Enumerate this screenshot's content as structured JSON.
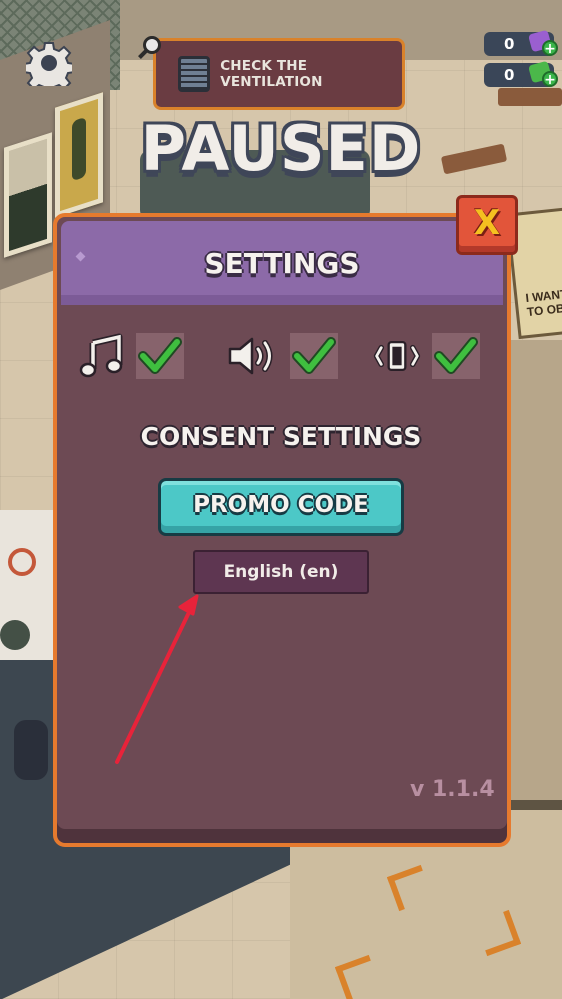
{
  "hud": {
    "objective_label": "CHECK THE VENTILATION",
    "currencies": [
      {
        "icon": "purple-gem-icon",
        "amount": "0",
        "color": "#9a5fd0"
      },
      {
        "icon": "green-cash-icon",
        "amount": "0",
        "color": "#4bb84a"
      }
    ]
  },
  "status_title": "PAUSED",
  "settings": {
    "title": "SETTINGS",
    "toggles": [
      {
        "name": "music",
        "icon": "music-note-icon",
        "enabled": true
      },
      {
        "name": "sound",
        "icon": "speaker-icon",
        "enabled": true
      },
      {
        "name": "vibration",
        "icon": "vibration-icon",
        "enabled": true
      }
    ],
    "consent_label": "CONSENT SETTINGS",
    "promo_label": "PROMO CODE",
    "language_label": "English (en)",
    "version": "v 1.1.4",
    "close_label": "X"
  },
  "background": {
    "poster_text": "I WANT TO OB"
  },
  "colors": {
    "dialog_bg": "#6d4a54",
    "dialog_border": "#e67a2e",
    "header_bg": "#8c6aa8",
    "promo_bg": "#4cc8c7",
    "check_green": "#3fbf3f",
    "close_red": "#e2553a",
    "arrow_red": "#e8233a"
  }
}
